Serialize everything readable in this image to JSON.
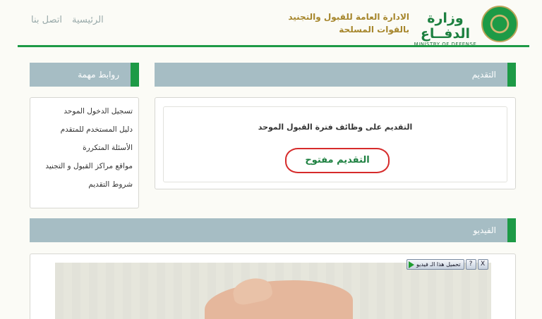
{
  "header": {
    "nav": [
      {
        "label": "الرئيسية"
      },
      {
        "label": "اتصل بنا"
      }
    ],
    "agency_line1": "الادارة العامة للقبول والتجنيد",
    "agency_line2": "بالقوات المسلحة",
    "ministry_ar": "وزارة الدفــاع",
    "ministry_en": "MINISTRY OF DEFENSE"
  },
  "apply": {
    "bar_title": "التقديم",
    "heading": "التقديم على وظائف فترة القبول الموحد",
    "status": "التقديم مفتوح"
  },
  "links": {
    "bar_title": "روابط مهمة",
    "items": [
      {
        "label": "تسجيل الدخول الموحد"
      },
      {
        "label": "دليل المستخدم للمتقدم"
      },
      {
        "label": "الأسئلة المتكررة"
      },
      {
        "label": "مواقع مراكز القبول و التجنيد"
      },
      {
        "label": "شروط التقديم"
      }
    ]
  },
  "video": {
    "bar_title": "الفيديو",
    "toolbar": {
      "close": "X",
      "help": "?",
      "download_label": "تحميل هذا الـ فيديو"
    }
  },
  "colors": {
    "accent_green": "#1d9a46",
    "bar_gray": "#a6bdc4",
    "highlight_red": "#d62b2b",
    "gold": "#a6862c"
  }
}
